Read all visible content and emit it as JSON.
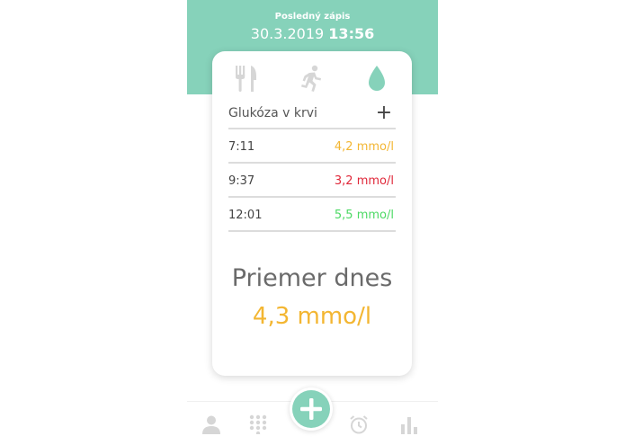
{
  "header": {
    "label": "Posledný zápis",
    "date": "30.3.2019",
    "time": "13:56"
  },
  "categories": [
    {
      "icon": "fork-knife-icon",
      "active": false
    },
    {
      "icon": "running-person-icon",
      "active": false
    },
    {
      "icon": "drop-icon",
      "active": true
    }
  ],
  "section": {
    "title": "Glukóza v krvi",
    "add_symbol": "+"
  },
  "readings": [
    {
      "time": "7:11",
      "value": "4,2 mmo/l",
      "color": "#f3b632"
    },
    {
      "time": "9:37",
      "value": "3,2 mmo/l",
      "color": "#e0283a"
    },
    {
      "time": "12:01",
      "value": "5,5 mmo/l",
      "color": "#4cd964"
    }
  ],
  "average": {
    "title": "Priemer dnes",
    "value": "4,3 mmo/l",
    "color": "#f3b632"
  },
  "colors": {
    "accent": "#86d2ba",
    "inactive_icon": "#d6d6d6"
  },
  "nav": {
    "items": [
      {
        "icon": "user-icon"
      },
      {
        "icon": "keypad-icon"
      },
      {
        "icon": "add-icon"
      },
      {
        "icon": "alarm-clock-icon"
      },
      {
        "icon": "bar-chart-icon"
      }
    ]
  }
}
